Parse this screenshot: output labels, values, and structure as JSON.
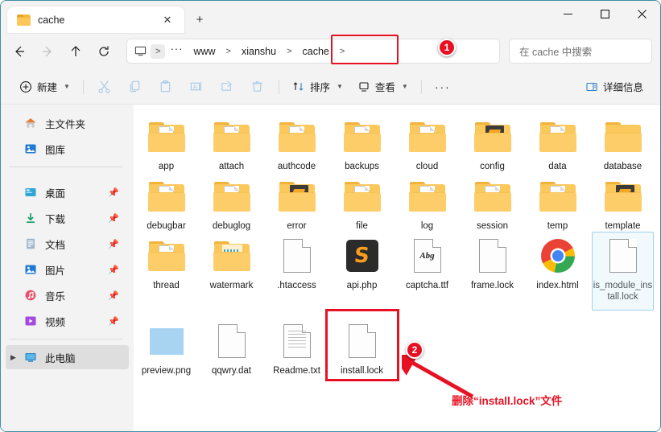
{
  "window": {
    "tab_title": "cache",
    "close_tab_label": "✕",
    "new_tab_label": "+",
    "minimize_label": "—",
    "maximize_label": "□",
    "close_label": "✕",
    "accent_border": "#3f8fa5"
  },
  "nav": {
    "back_label": "←",
    "forward_label": "→",
    "up_label": "↑",
    "refresh_label": "↻",
    "breadcrumb": [
      {
        "label": "🖵",
        "type": "pc-icon"
      },
      {
        "label": ">",
        "type": "sep-shaded"
      },
      {
        "label": "···",
        "type": "ellipsis"
      },
      {
        "label": "www",
        "type": "crumb"
      },
      {
        "label": ">",
        "type": "sep"
      },
      {
        "label": "xianshu",
        "type": "crumb"
      },
      {
        "label": ">",
        "type": "sep"
      },
      {
        "label": "cache",
        "type": "crumb"
      },
      {
        "label": ">",
        "type": "sep"
      }
    ],
    "search_placeholder": "在 cache 中搜索"
  },
  "toolbar": {
    "new_label": "新建",
    "cut_label": "cut",
    "copy_label": "copy",
    "paste_label": "paste",
    "rename_label": "rename",
    "share_label": "share",
    "delete_label": "delete",
    "sort_label": "排序",
    "view_label": "查看",
    "more_label": "···",
    "details_label": "详细信息"
  },
  "sidebar": {
    "items": [
      {
        "label": "主文件夹",
        "icon": "home-icon",
        "pinned": false,
        "selected": false,
        "expander": false
      },
      {
        "label": "图库",
        "icon": "gallery-icon",
        "pinned": false,
        "selected": false,
        "expander": false
      },
      {
        "label": "桌面",
        "icon": "desktop-icon",
        "pinned": true,
        "selected": false,
        "expander": false
      },
      {
        "label": "下载",
        "icon": "downloads-icon",
        "pinned": true,
        "selected": false,
        "expander": false
      },
      {
        "label": "文档",
        "icon": "documents-icon",
        "pinned": true,
        "selected": false,
        "expander": false
      },
      {
        "label": "图片",
        "icon": "pictures-icon",
        "pinned": true,
        "selected": false,
        "expander": false
      },
      {
        "label": "音乐",
        "icon": "music-icon",
        "pinned": true,
        "selected": false,
        "expander": false
      },
      {
        "label": "视频",
        "icon": "videos-icon",
        "pinned": true,
        "selected": false,
        "expander": false
      },
      {
        "label": "此电脑",
        "icon": "this-pc-icon",
        "pinned": false,
        "selected": true,
        "expander": true
      }
    ],
    "pin_glyph": "📌"
  },
  "files": [
    {
      "name": "app",
      "kind": "folder-doc"
    },
    {
      "name": "attach",
      "kind": "folder-doc"
    },
    {
      "name": "authcode",
      "kind": "folder-doc"
    },
    {
      "name": "backups",
      "kind": "folder-doc"
    },
    {
      "name": "cloud",
      "kind": "folder-doc"
    },
    {
      "name": "config",
      "kind": "folder-dark"
    },
    {
      "name": "data",
      "kind": "folder-doc"
    },
    {
      "name": "database",
      "kind": "folder-empty"
    },
    {
      "name": "debugbar",
      "kind": "folder-doc"
    },
    {
      "name": "debuglog",
      "kind": "folder-doc"
    },
    {
      "name": "error",
      "kind": "folder-dark"
    },
    {
      "name": "file",
      "kind": "folder-doc"
    },
    {
      "name": "log",
      "kind": "folder-doc"
    },
    {
      "name": "session",
      "kind": "folder-doc"
    },
    {
      "name": "temp",
      "kind": "folder-doc"
    },
    {
      "name": "template",
      "kind": "folder-dark"
    },
    {
      "name": "thread",
      "kind": "folder-doc"
    },
    {
      "name": "watermark",
      "kind": "folder-watermark"
    },
    {
      "name": ".htaccess",
      "kind": "page-blank"
    },
    {
      "name": "api.php",
      "kind": "sublime"
    },
    {
      "name": "captcha.ttf",
      "kind": "page-font"
    },
    {
      "name": "frame.lock",
      "kind": "page-blank"
    },
    {
      "name": "index.html",
      "kind": "chrome"
    },
    {
      "name": "is_module_install.lock",
      "kind": "page-blank",
      "selected": true
    },
    {
      "name": "preview.png",
      "kind": "thumb-png"
    },
    {
      "name": "qqwry.dat",
      "kind": "page-blank"
    },
    {
      "name": "Readme.txt",
      "kind": "page-text"
    },
    {
      "name": "install.lock",
      "kind": "page-blank",
      "highlighted": true
    }
  ],
  "annotations": {
    "badge1": "1",
    "badge2": "2",
    "note_text": "删除“install.lock”文件",
    "color": "#e81123"
  }
}
